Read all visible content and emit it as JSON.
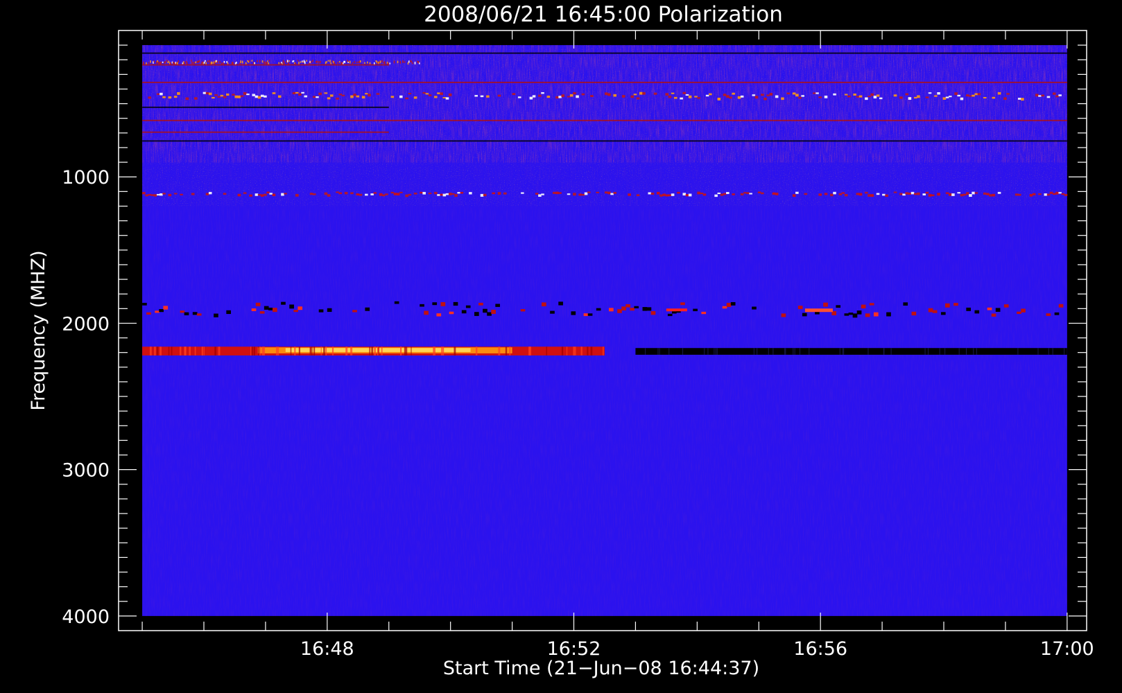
{
  "chart_data": {
    "type": "heatmap",
    "title": "2008/06/21 16:45:00 Polarization",
    "xlabel": "Start Time (21−Jun−08 16:44:37)",
    "ylabel": "Frequency (MHZ)",
    "x_range": [
      "16:45:00",
      "17:00:00"
    ],
    "x_axis_range": [
      "16:44:37",
      "17:00:19"
    ],
    "x_ticks": [
      "16:48",
      "16:52",
      "16:56",
      "17:00"
    ],
    "y_range": [
      100,
      4000
    ],
    "y_axis_range": [
      0,
      4100
    ],
    "y_inverted": true,
    "y_ticks": [
      1000,
      2000,
      3000,
      4000
    ],
    "colors": {
      "background": "#000000",
      "base": "#2b12ee",
      "low": "#000000",
      "mid": "#d01010",
      "high": "#ff9a10",
      "peak": "#ffe060"
    },
    "features": [
      {
        "name": "rfi-band-dense-top",
        "freq_mhz": [
          100,
          900
        ],
        "intensity": "noisy"
      },
      {
        "name": "rfi-band-top-bright",
        "freq_mhz": [
          200,
          230
        ],
        "time": [
          "16:45:00",
          "16:49:30"
        ],
        "intensity": "high"
      },
      {
        "name": "rfi-band-450",
        "freq_mhz": [
          420,
          470
        ],
        "time": [
          "16:45:00",
          "17:00:00"
        ],
        "intensity": "high"
      },
      {
        "name": "rfi-band-1100",
        "freq_mhz": [
          1100,
          1130
        ],
        "time": [
          "16:45:00",
          "17:00:00"
        ],
        "intensity": "mid"
      },
      {
        "name": "band-1900",
        "freq_mhz": [
          1850,
          1960
        ],
        "time": [
          "16:45:00",
          "17:00:00"
        ],
        "intensity": "mixed"
      },
      {
        "name": "band-2200-bright",
        "freq_mhz": [
          2160,
          2220
        ],
        "time": [
          "16:45:00",
          "16:52:30"
        ],
        "intensity": "peak"
      },
      {
        "name": "band-2200-dark",
        "freq_mhz": [
          2160,
          2220
        ],
        "time": [
          "16:53:00",
          "17:00:00"
        ],
        "intensity": "low"
      }
    ]
  }
}
